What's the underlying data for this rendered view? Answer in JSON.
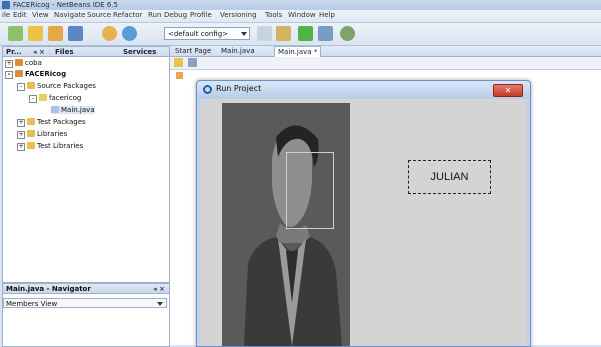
{
  "window": {
    "title": "FACERicog - NetBeans IDE 6.5"
  },
  "menu": [
    "ile",
    "Edit",
    "View",
    "Navigate",
    "Source",
    "Refactor",
    "Run",
    "Debug",
    "Profile",
    "Versioning",
    "Tools",
    "Window",
    "Help"
  ],
  "toolbar": {
    "config_value": "<default config>"
  },
  "left_panel": {
    "tabs": [
      "Pr...",
      "Files",
      "Services"
    ],
    "tree": [
      {
        "label": "coba",
        "level": 0,
        "toggle": "+"
      },
      {
        "label": "FACERicog",
        "level": 0,
        "toggle": "-",
        "bold": true
      },
      {
        "label": "Source Packages",
        "level": 1,
        "toggle": "-"
      },
      {
        "label": "facericog",
        "level": 2,
        "toggle": "-"
      },
      {
        "label": "Main.java",
        "level": 3,
        "toggle": ""
      },
      {
        "label": "Test Packages",
        "level": 1,
        "toggle": "+"
      },
      {
        "label": "Libraries",
        "level": 1,
        "toggle": "+"
      },
      {
        "label": "Test Libraries",
        "level": 1,
        "toggle": "+"
      }
    ]
  },
  "navigator": {
    "title": "Main.java - Navigator",
    "view": "Members View"
  },
  "editor_tabs": [
    "Start Page",
    "Main.java",
    "Main.java *"
  ],
  "dialog": {
    "title": "Run Project",
    "recognized_name": "JULIAN"
  },
  "colors": {
    "accent": "#3d6fb6",
    "close": "#c33b28",
    "dialog_bg": "#d4d4d4"
  }
}
